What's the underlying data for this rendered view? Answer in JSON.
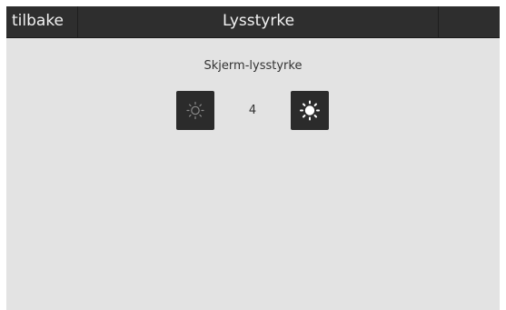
{
  "header": {
    "back_label": "tilbake",
    "title": "Lysstyrke"
  },
  "brightness": {
    "label": "Skjerm-lysstyrke",
    "value": "4",
    "decrease_icon": "sun-outline-icon",
    "increase_icon": "sun-filled-icon"
  },
  "colors": {
    "topbar": "#2e2e2e",
    "background": "#e3e3e3",
    "button": "#2b2b2b"
  }
}
